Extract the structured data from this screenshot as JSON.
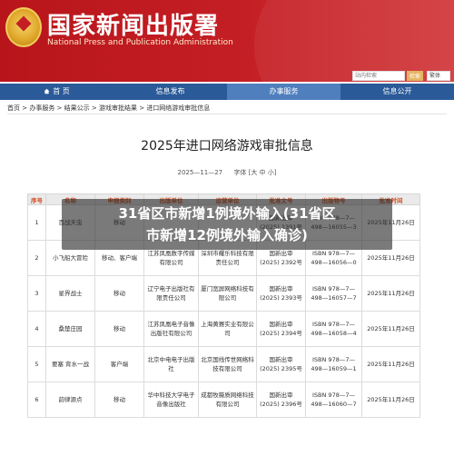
{
  "header": {
    "site_title": "国家新闻出版署",
    "site_subtitle": "National Press and Publication Administration",
    "search_placeholder": "站内检索",
    "search_button": "检索",
    "lang_select": "繁体"
  },
  "nav": [
    {
      "label": "首 页",
      "icon": "home-icon",
      "active": false
    },
    {
      "label": "信息发布",
      "active": false
    },
    {
      "label": "办事服务",
      "active": true
    },
    {
      "label": "信息公开",
      "active": false
    }
  ],
  "breadcrumb": [
    "首页",
    "办事服务",
    "结果公示",
    "游戏审批结果",
    "进口网络游戏审批信息"
  ],
  "article": {
    "title": "2025年进口网络游戏审批信息",
    "date": "2025—11—27",
    "font_size_label": "字体",
    "font_size_options": "[大 中 小]"
  },
  "overlay": {
    "line1": "31省区市新增1例境外输入(31省区",
    "line2": "市新增12例境外输入确诊)"
  },
  "table": {
    "headers": [
      "序号",
      "名称",
      "申报类别",
      "出版单位",
      "运营单位",
      "批准文号",
      "出版物号",
      "批准时间"
    ],
    "rows": [
      [
        "1",
        "百战天虫",
        "移动",
        "",
        "",
        "国新出审\n(2025) 2391号",
        "ISBN 978—7—498—16055—3",
        "2025年11月26日"
      ],
      [
        "2",
        "小飞船大冒险",
        "移动、客户端",
        "江苏凤凰数字传媒有限公司",
        "深圳市耀乐科技有限责任公司",
        "国新出审\n(2025) 2392号",
        "ISBN 978—7—498—16056—0",
        "2025年11月26日"
      ],
      [
        "3",
        "星界战士",
        "移动",
        "辽宁电子出版社有限责任公司",
        "厦门宽屏网络科技有限公司",
        "国新出审\n(2025) 2393号",
        "ISBN 978—7—498—16057—7",
        "2025年11月26日"
      ],
      [
        "4",
        "桑楚庄园",
        "移动",
        "江苏凤凰电子音像出版社有限公司",
        "上海黄赛实业有限公司",
        "国新出审\n(2025) 2394号",
        "ISBN 978—7—498—16058—4",
        "2025年11月26日"
      ],
      [
        "5",
        "要塞 背水一战",
        "客户端",
        "北京中电电子出版社",
        "北京国线传世网络科技有限公司",
        "国新出审\n(2025) 2395号",
        "ISBN 978—7—498—16059—1",
        "2025年11月26日"
      ],
      [
        "6",
        "韵律源点",
        "移动",
        "华中科技大学电子音像出版社",
        "成都牧薇质网络科技有限公司",
        "国新出审\n(2025) 2396号",
        "ISBN 978—7—498—16060—7",
        "2025年11月26日"
      ]
    ]
  },
  "colors": {
    "banner": "#c41f25",
    "nav": "#2b5a98",
    "nav_active": "#4f7fbd",
    "table_header_text": "#d04a1a"
  }
}
